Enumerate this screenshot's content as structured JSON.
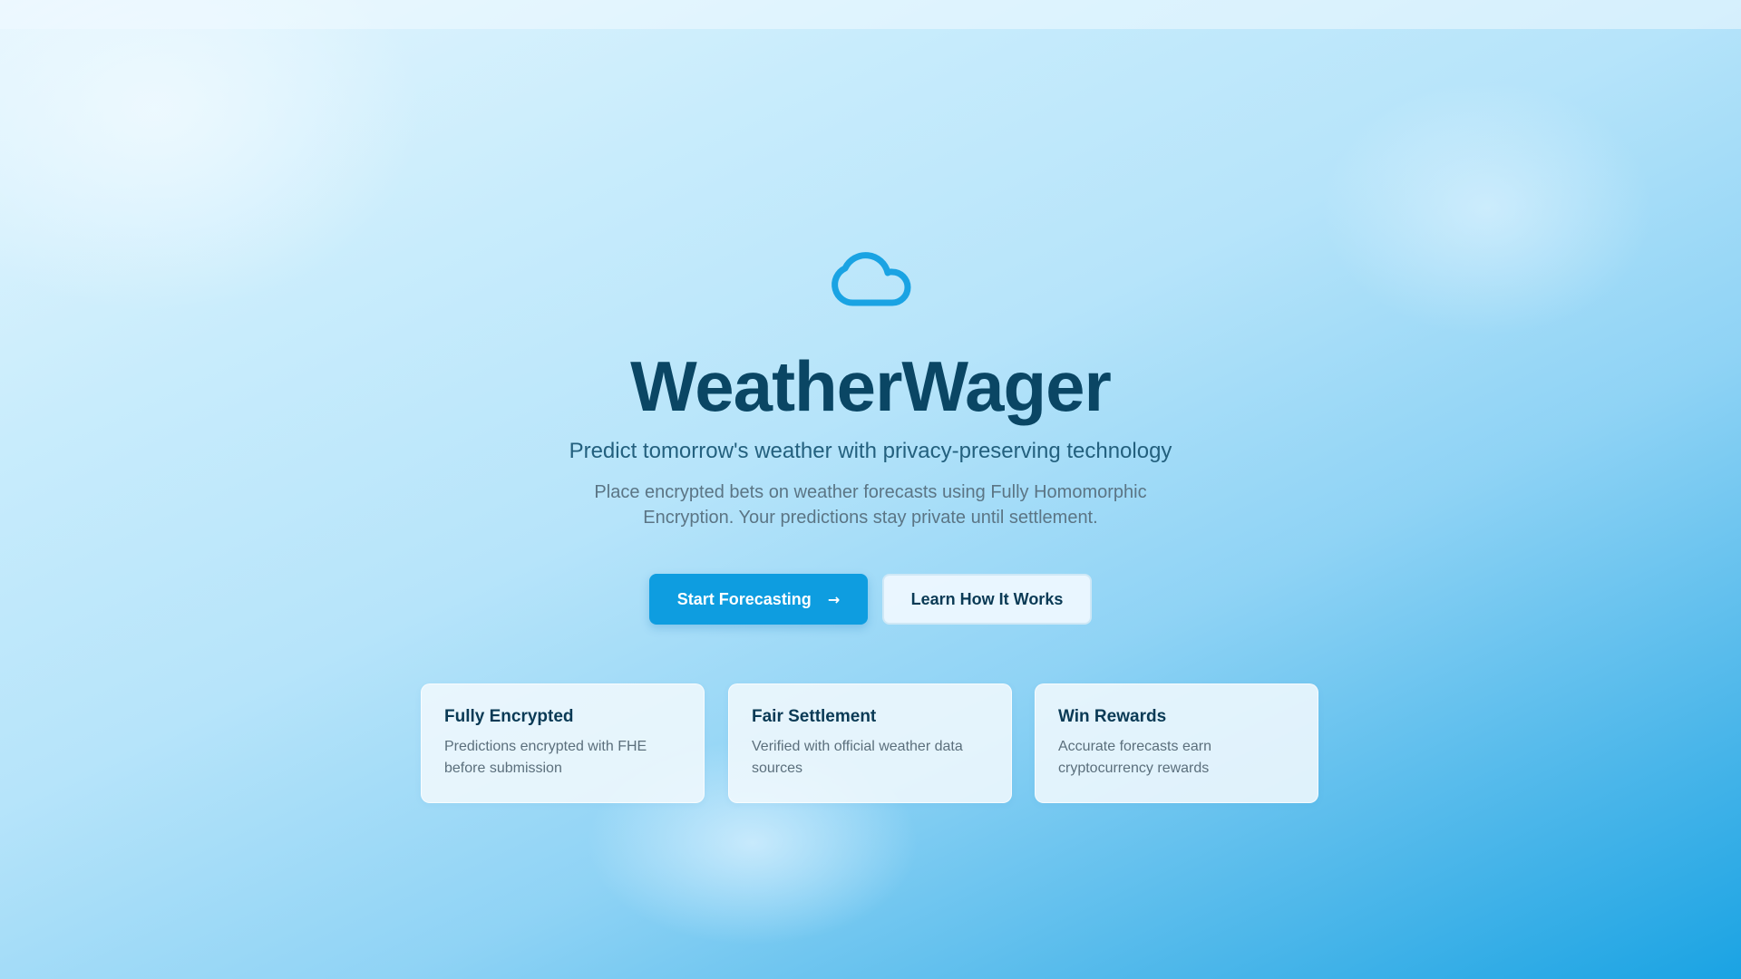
{
  "hero": {
    "icon": "cloud-icon",
    "title": "WeatherWager",
    "subtitle": "Predict tomorrow's weather with privacy-preserving technology",
    "description": "Place encrypted bets on weather forecasts using Fully Homomorphic Encryption. Your predictions stay private until settlement."
  },
  "buttons": {
    "primary_label": "Start Forecasting",
    "primary_icon": "arrow-right-icon",
    "secondary_label": "Learn How It Works"
  },
  "features": [
    {
      "title": "Fully Encrypted",
      "text": "Predictions encrypted with FHE before submission"
    },
    {
      "title": "Fair Settlement",
      "text": "Verified with official weather data sources"
    },
    {
      "title": "Win Rewards",
      "text": "Accurate forecasts earn cryptocurrency rewards"
    }
  ],
  "colors": {
    "accent": "#0e9de0",
    "title": "#0a4664",
    "icon": "#1aa3e3"
  }
}
